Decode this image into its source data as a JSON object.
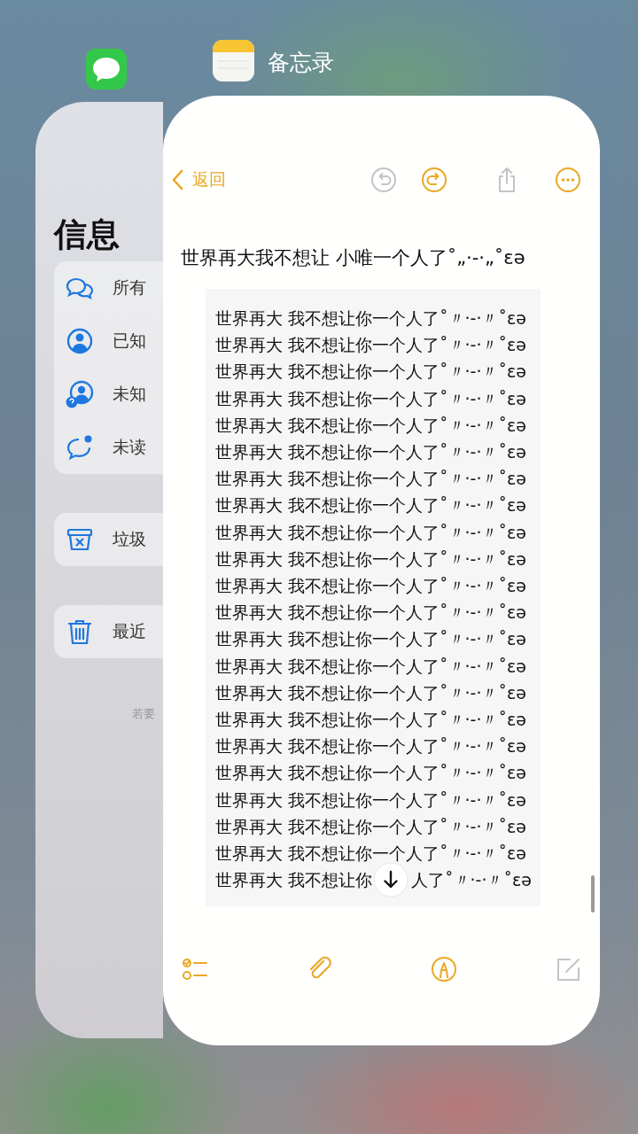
{
  "messages_app": {
    "title": "信息",
    "groups": [
      [
        {
          "kind": "all",
          "label": "所有"
        },
        {
          "kind": "known",
          "label": "已知"
        },
        {
          "kind": "unknown",
          "label": "未知"
        },
        {
          "kind": "unread",
          "label": "未读"
        }
      ],
      [
        {
          "kind": "junk",
          "label": "垃圾"
        }
      ],
      [
        {
          "kind": "deleted",
          "label": "最近"
        }
      ]
    ],
    "footer": "若要"
  },
  "notes_app": {
    "app_label": "备忘录",
    "nav": {
      "back": "返回",
      "buttons": [
        {
          "kind": "undo",
          "disabled": true
        },
        {
          "kind": "redo",
          "disabled": false
        },
        {
          "kind": "share",
          "disabled": true
        },
        {
          "kind": "more",
          "disabled": false
        }
      ]
    },
    "title": "世界再大我不想让 小唯一个人了˚„·-·„˚ɛə",
    "lines": [
      "世界再大 我不想让你一个人了˚〃·-·〃˚ɛə",
      "世界再大 我不想让你一个人了˚〃·-·〃˚ɛə",
      "世界再大 我不想让你一个人了˚〃·-·〃˚ɛə",
      "世界再大 我不想让你一个人了˚〃·-·〃˚ɛə",
      "世界再大 我不想让你一个人了˚〃·-·〃˚ɛə",
      "世界再大 我不想让你一个人了˚〃·-·〃˚ɛə",
      "世界再大 我不想让你一个人了˚〃·-·〃˚ɛə",
      "世界再大 我不想让你一个人了˚〃·-·〃˚ɛə",
      "世界再大 我不想让你一个人了˚〃·-·〃˚ɛə",
      "世界再大 我不想让你一个人了˚〃·-·〃˚ɛə",
      "世界再大 我不想让你一个人了˚〃·-·〃˚ɛə",
      "世界再大 我不想让你一个人了˚〃·-·〃˚ɛə",
      "世界再大 我不想让你一个人了˚〃·-·〃˚ɛə",
      "世界再大 我不想让你一个人了˚〃·-·〃˚ɛə",
      "世界再大 我不想让你一个人了˚〃·-·〃˚ɛə",
      "世界再大 我不想让你一个人了˚〃·-·〃˚ɛə",
      "世界再大 我不想让你一个人了˚〃·-·〃˚ɛə",
      "世界再大 我不想让你一个人了˚〃·-·〃˚ɛə",
      "世界再大 我不想让你一个人了˚〃·-·〃˚ɛə",
      "世界再大 我不想让你一个人了˚〃·-·〃˚ɛə",
      "世界再大 我不想让你一个人了˚〃·-·〃˚ɛə"
    ],
    "covered_line": [
      "世界再大 我不想让你",
      "人了˚〃·-·〃˚ɛə"
    ],
    "toolbar": [
      {
        "kind": "checklist",
        "disabled": false
      },
      {
        "kind": "attach",
        "disabled": false
      },
      {
        "kind": "markup",
        "disabled": false
      },
      {
        "kind": "compose",
        "disabled": true
      }
    ]
  }
}
